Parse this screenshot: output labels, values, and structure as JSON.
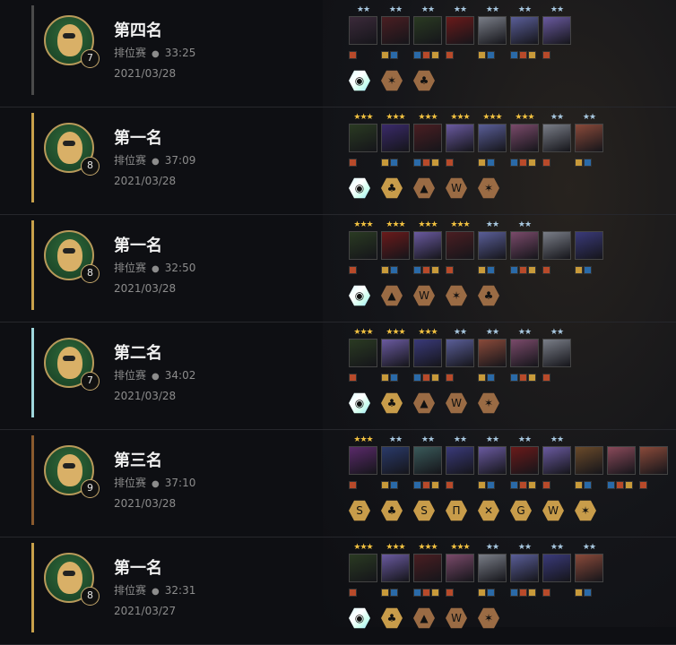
{
  "colors": {
    "prismatic": "#dff",
    "gold": "#c89c4a",
    "bronze": "#9a6b44",
    "silver": "#9ea6ad",
    "bar_4": "#5a5a5a",
    "bar_1": "#c8a04a",
    "bar_2": "#9fd7dc",
    "bar_3": "#8a5a2e"
  },
  "matches": [
    {
      "place": "第四名",
      "level": "7",
      "mode": "排位赛",
      "duration": "33:25",
      "date": "2021/03/28",
      "bar_color": "#4a4a4a",
      "units": [
        {
          "stars": "★★",
          "tier": 2,
          "color": "#3b2a3a"
        },
        {
          "stars": "★★",
          "tier": 2,
          "color": "#4a1e22"
        },
        {
          "stars": "★★",
          "tier": 2,
          "color": "#2a3a22"
        },
        {
          "stars": "★★",
          "tier": 2,
          "color": "#6a1a1a"
        },
        {
          "stars": "★★",
          "tier": 2,
          "color": "#7a7e88"
        },
        {
          "stars": "★★",
          "tier": 2,
          "color": "#5a5e98"
        },
        {
          "stars": "★★",
          "tier": 2,
          "color": "#6a5aa0"
        }
      ],
      "traits": [
        {
          "tier": "prismatic",
          "symbol": "◉"
        },
        {
          "tier": "bronze",
          "symbol": "✶"
        },
        {
          "tier": "bronze",
          "symbol": "♣"
        }
      ]
    },
    {
      "place": "第一名",
      "level": "8",
      "mode": "排位赛",
      "duration": "37:09",
      "date": "2021/03/28",
      "bar_color": "#c8a04a",
      "units": [
        {
          "stars": "★★★",
          "tier": 3,
          "color": "#2a3a22"
        },
        {
          "stars": "★★★",
          "tier": 3,
          "color": "#3a2a6a"
        },
        {
          "stars": "★★★",
          "tier": 3,
          "color": "#4a1e22"
        },
        {
          "stars": "★★★",
          "tier": 3,
          "color": "#6a5aa0"
        },
        {
          "stars": "★★★",
          "tier": 3,
          "color": "#5a5e98"
        },
        {
          "stars": "★★★",
          "tier": 3,
          "color": "#7a4a6a"
        },
        {
          "stars": "★★",
          "tier": 2,
          "color": "#7a7e88"
        },
        {
          "stars": "★★",
          "tier": 2,
          "color": "#8a4a3a"
        }
      ],
      "traits": [
        {
          "tier": "prismatic",
          "symbol": "◉"
        },
        {
          "tier": "gold",
          "symbol": "♣"
        },
        {
          "tier": "bronze",
          "symbol": "▲"
        },
        {
          "tier": "bronze",
          "symbol": "W"
        },
        {
          "tier": "bronze",
          "symbol": "✶"
        }
      ]
    },
    {
      "place": "第一名",
      "level": "8",
      "mode": "排位赛",
      "duration": "32:50",
      "date": "2021/03/28",
      "bar_color": "#c8a04a",
      "units": [
        {
          "stars": "★★★",
          "tier": 3,
          "color": "#2a3a22"
        },
        {
          "stars": "★★★",
          "tier": 3,
          "color": "#6a1a1a"
        },
        {
          "stars": "★★★",
          "tier": 3,
          "color": "#6a5aa0"
        },
        {
          "stars": "★★★",
          "tier": 3,
          "color": "#4a1e22"
        },
        {
          "stars": "★★",
          "tier": 2,
          "color": "#5a5e98"
        },
        {
          "stars": "★★",
          "tier": 2,
          "color": "#7a4a6a"
        },
        {
          "stars": "",
          "tier": 0,
          "color": "#7a7e88"
        },
        {
          "stars": "",
          "tier": 0,
          "color": "#3a3a7a"
        }
      ],
      "traits": [
        {
          "tier": "prismatic",
          "symbol": "◉"
        },
        {
          "tier": "bronze",
          "symbol": "▲"
        },
        {
          "tier": "bronze",
          "symbol": "W"
        },
        {
          "tier": "bronze",
          "symbol": "✶"
        },
        {
          "tier": "bronze",
          "symbol": "♣"
        }
      ]
    },
    {
      "place": "第二名",
      "level": "7",
      "mode": "排位赛",
      "duration": "34:02",
      "date": "2021/03/28",
      "bar_color": "#9fd7dc",
      "units": [
        {
          "stars": "★★★",
          "tier": 3,
          "color": "#2a3a22"
        },
        {
          "stars": "★★★",
          "tier": 3,
          "color": "#6a5aa0"
        },
        {
          "stars": "★★★",
          "tier": 3,
          "color": "#3a3a7a"
        },
        {
          "stars": "★★",
          "tier": 2,
          "color": "#5a5e98"
        },
        {
          "stars": "★★",
          "tier": 2,
          "color": "#8a4a3a"
        },
        {
          "stars": "★★",
          "tier": 2,
          "color": "#7a4a6a"
        },
        {
          "stars": "★★",
          "tier": 2,
          "color": "#7a7e88"
        }
      ],
      "traits": [
        {
          "tier": "prismatic",
          "symbol": "◉"
        },
        {
          "tier": "gold",
          "symbol": "♣"
        },
        {
          "tier": "bronze",
          "symbol": "▲"
        },
        {
          "tier": "bronze",
          "symbol": "W"
        },
        {
          "tier": "bronze",
          "symbol": "✶"
        }
      ]
    },
    {
      "place": "第三名",
      "level": "9",
      "mode": "排位赛",
      "duration": "37:10",
      "date": "2021/03/28",
      "bar_color": "#8a5a2e",
      "units": [
        {
          "stars": "★★★",
          "tier": 3,
          "color": "#5a2a6a"
        },
        {
          "stars": "★★",
          "tier": 2,
          "color": "#2a3a6a"
        },
        {
          "stars": "★★",
          "tier": 2,
          "color": "#3a5a5a"
        },
        {
          "stars": "★★",
          "tier": 2,
          "color": "#3a3a7a"
        },
        {
          "stars": "★★",
          "tier": 2,
          "color": "#6a5aa0"
        },
        {
          "stars": "★★",
          "tier": 2,
          "color": "#6a1a1a"
        },
        {
          "stars": "★★",
          "tier": 2,
          "color": "#6a5aa0"
        },
        {
          "stars": "",
          "tier": 0,
          "color": "#6a4a2a"
        },
        {
          "stars": "",
          "tier": 0,
          "color": "#8a4a5a"
        },
        {
          "stars": "",
          "tier": 0,
          "color": "#8a4a3a"
        }
      ],
      "traits": [
        {
          "tier": "gold",
          "symbol": "S"
        },
        {
          "tier": "gold",
          "symbol": "♣"
        },
        {
          "tier": "gold",
          "symbol": "S"
        },
        {
          "tier": "gold",
          "symbol": "Π"
        },
        {
          "tier": "gold",
          "symbol": "✕"
        },
        {
          "tier": "gold",
          "symbol": "G"
        },
        {
          "tier": "gold",
          "symbol": "W"
        },
        {
          "tier": "gold",
          "symbol": "✶"
        }
      ]
    },
    {
      "place": "第一名",
      "level": "8",
      "mode": "排位赛",
      "duration": "32:31",
      "date": "2021/03/27",
      "bar_color": "#c8a04a",
      "units": [
        {
          "stars": "★★★",
          "tier": 3,
          "color": "#2a3a22"
        },
        {
          "stars": "★★★",
          "tier": 3,
          "color": "#6a5aa0"
        },
        {
          "stars": "★★★",
          "tier": 3,
          "color": "#4a1e22"
        },
        {
          "stars": "★★★",
          "tier": 3,
          "color": "#7a4a6a"
        },
        {
          "stars": "★★",
          "tier": 2,
          "color": "#7a7e88"
        },
        {
          "stars": "★★",
          "tier": 2,
          "color": "#5a5e98"
        },
        {
          "stars": "★★",
          "tier": 2,
          "color": "#3a3a7a"
        },
        {
          "stars": "★★",
          "tier": 2,
          "color": "#8a4a3a"
        }
      ],
      "traits": [
        {
          "tier": "prismatic",
          "symbol": "◉"
        },
        {
          "tier": "gold",
          "symbol": "♣"
        },
        {
          "tier": "bronze",
          "symbol": "▲"
        },
        {
          "tier": "bronze",
          "symbol": "W"
        },
        {
          "tier": "bronze",
          "symbol": "✶"
        }
      ]
    }
  ]
}
